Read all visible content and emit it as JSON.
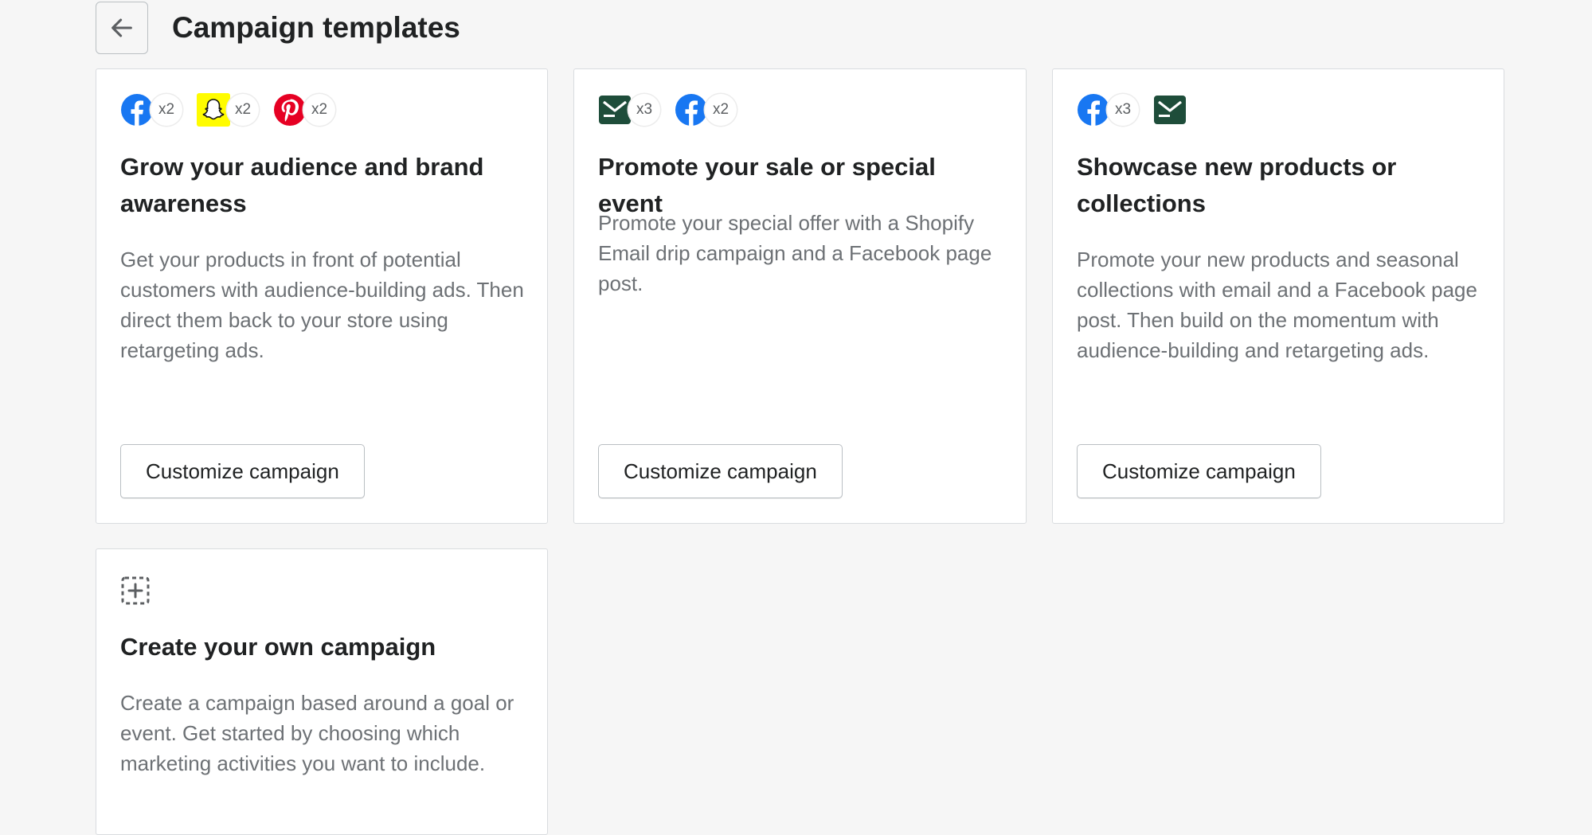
{
  "page": {
    "title": "Campaign templates"
  },
  "colors": {
    "facebook": "#1877F2",
    "snapchat": "#FFFC00",
    "pinterest": "#E60023",
    "email": "#1e4d3a"
  },
  "cards": [
    {
      "icons": [
        {
          "icon": "facebook-icon",
          "count": "x2"
        },
        {
          "icon": "snapchat-icon",
          "count": "x2"
        },
        {
          "icon": "pinterest-icon",
          "count": "x2"
        }
      ],
      "title": "Grow your audience and brand awareness",
      "description": "Get your products in front of potential customers with audience-building ads. Then direct them back to your store using retargeting ads.",
      "cta": "Customize campaign"
    },
    {
      "icons": [
        {
          "icon": "email-icon",
          "count": "x3"
        },
        {
          "icon": "facebook-icon",
          "count": "x2"
        }
      ],
      "title": "Promote your sale or special event",
      "description": "Promote your special offer with a Shopify Email drip campaign and a Facebook page post.",
      "cta": "Customize campaign"
    },
    {
      "icons": [
        {
          "icon": "facebook-icon",
          "count": "x3"
        },
        {
          "icon": "email-icon"
        }
      ],
      "title": "Showcase new products or collections",
      "description": "Promote your new products and seasonal collections with email and a Facebook page post. Then build on the momentum with audience-building and retargeting ads.",
      "cta": "Customize campaign"
    },
    {
      "icons": [
        {
          "icon": "add-dashed-square-icon"
        }
      ],
      "title": "Create your own campaign",
      "description": "Create a campaign based around a goal or event. Get started by choosing which marketing activities you want to include."
    }
  ]
}
